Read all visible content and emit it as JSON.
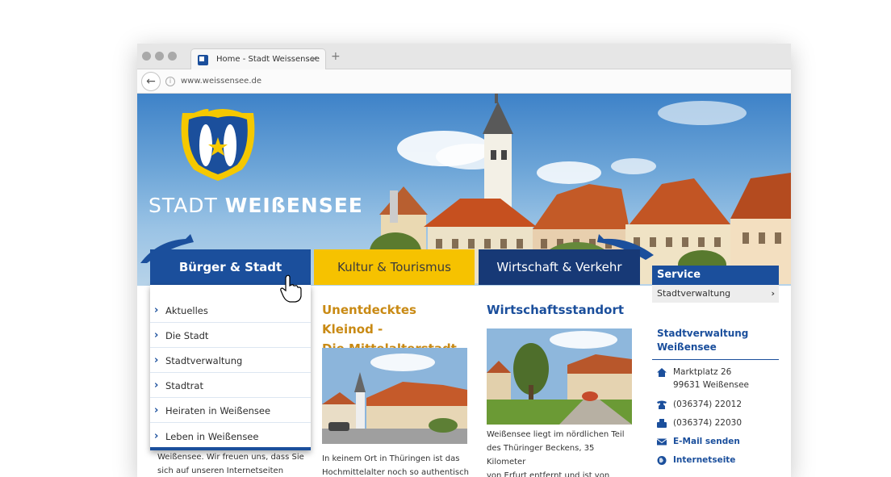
{
  "browser": {
    "tab_title": "Home - Stadt Weissensee",
    "tab_close": "×",
    "new_tab": "+",
    "url": "www.weissensee.de"
  },
  "header": {
    "logo_light": "STADT ",
    "logo_bold": "WEIßENSEE"
  },
  "nav": {
    "tabs": [
      {
        "label": "Bürger & Stadt",
        "color": "#1b4f9c"
      },
      {
        "label": "Kultur & Tourismus",
        "color": "#f6c200"
      },
      {
        "label": "Wirtschaft & Verkehr",
        "color": "#173976"
      }
    ]
  },
  "dropdown": {
    "items": [
      {
        "label": "Aktuelles"
      },
      {
        "label": "Die Stadt"
      },
      {
        "label": "Stadtverwaltung"
      },
      {
        "label": "Stadtrat"
      },
      {
        "label": "Heiraten in Weißensee"
      },
      {
        "label": "Leben in Weißensee"
      }
    ]
  },
  "intro_behind": {
    "line1": "Weißensee. Wir freuen uns, dass Sie",
    "line2": "sich auf unseren Internetseiten"
  },
  "articles": [
    {
      "title_line1": "Unentdecktes Kleinod -",
      "title_line2": "Die Mittelalterstadt",
      "text_line1": "In keinem Ort in Thüringen ist das",
      "text_line2": "Hochmittelalter noch so authentisch",
      "color": "#c98a14"
    },
    {
      "title_line1": "Wirtschaftsstandort",
      "text_line1": "Weißensee liegt im nördlichen Teil",
      "text_line2": "des Thüringer Beckens, 35 Kilometer",
      "text_line3": "von Erfurt entfernt und ist von",
      "color": "#1b4f9c"
    }
  ],
  "sidebar": {
    "heading": "Service",
    "item": "Stadtverwaltung",
    "item_arrow": "›",
    "admin_title_line1": "Stadtverwaltung",
    "admin_title_line2": "Weißensee",
    "address_line1": "Marktplatz 26",
    "address_line2": "99631 Weißensee",
    "phone": "(036374) 22012",
    "fax": "(036374) 22030",
    "email_link": "E-Mail senden",
    "web_link": "Internetseite"
  }
}
